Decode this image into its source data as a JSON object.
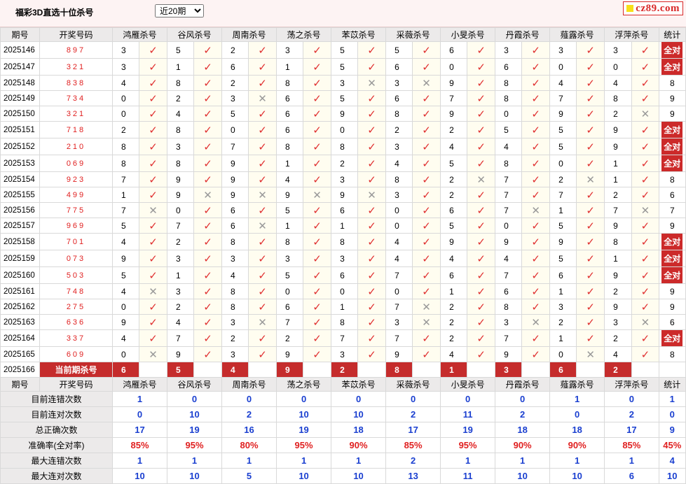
{
  "title": "福彩3D直选十位杀号",
  "period_select": {
    "selected": "近20期",
    "options": [
      "近20期"
    ]
  },
  "logo": {
    "text": "cz89.com"
  },
  "headers": [
    "期号",
    "开奖号码",
    "鸿雁杀号",
    "谷风杀号",
    "周南杀号",
    "荡之杀号",
    "苯苡杀号",
    "采薇杀号",
    "小旻杀号",
    "丹霞杀号",
    "薤露杀号",
    "浮萍杀号",
    "统计"
  ],
  "rows": [
    {
      "issue": "2025146",
      "win": "897",
      "picks": [
        [
          3,
          1
        ],
        [
          5,
          1
        ],
        [
          2,
          1
        ],
        [
          3,
          1
        ],
        [
          5,
          1
        ],
        [
          5,
          1
        ],
        [
          6,
          1
        ],
        [
          3,
          1
        ],
        [
          3,
          1
        ],
        [
          3,
          1
        ]
      ],
      "stat": "全对"
    },
    {
      "issue": "2025147",
      "win": "321",
      "picks": [
        [
          3,
          1
        ],
        [
          1,
          1
        ],
        [
          6,
          1
        ],
        [
          1,
          1
        ],
        [
          5,
          1
        ],
        [
          6,
          1
        ],
        [
          0,
          1
        ],
        [
          6,
          1
        ],
        [
          0,
          1
        ],
        [
          0,
          1
        ]
      ],
      "stat": "全对"
    },
    {
      "issue": "2025148",
      "win": "838",
      "picks": [
        [
          4,
          1
        ],
        [
          8,
          1
        ],
        [
          2,
          1
        ],
        [
          8,
          1
        ],
        [
          3,
          0
        ],
        [
          3,
          0
        ],
        [
          9,
          1
        ],
        [
          8,
          1
        ],
        [
          4,
          1
        ],
        [
          4,
          1
        ]
      ],
      "stat": "8"
    },
    {
      "issue": "2025149",
      "win": "734",
      "picks": [
        [
          0,
          1
        ],
        [
          2,
          1
        ],
        [
          3,
          0
        ],
        [
          6,
          1
        ],
        [
          5,
          1
        ],
        [
          6,
          1
        ],
        [
          7,
          1
        ],
        [
          8,
          1
        ],
        [
          7,
          1
        ],
        [
          8,
          1
        ]
      ],
      "stat": "9"
    },
    {
      "issue": "2025150",
      "win": "321",
      "picks": [
        [
          0,
          1
        ],
        [
          4,
          1
        ],
        [
          5,
          1
        ],
        [
          6,
          1
        ],
        [
          9,
          1
        ],
        [
          8,
          1
        ],
        [
          9,
          1
        ],
        [
          0,
          1
        ],
        [
          9,
          1
        ],
        [
          2,
          0
        ]
      ],
      "stat": "9"
    },
    {
      "issue": "2025151",
      "win": "718",
      "picks": [
        [
          2,
          1
        ],
        [
          8,
          1
        ],
        [
          0,
          1
        ],
        [
          6,
          1
        ],
        [
          0,
          1
        ],
        [
          2,
          1
        ],
        [
          2,
          1
        ],
        [
          5,
          1
        ],
        [
          5,
          1
        ],
        [
          9,
          1
        ]
      ],
      "stat": "全对"
    },
    {
      "issue": "2025152",
      "win": "210",
      "picks": [
        [
          8,
          1
        ],
        [
          3,
          1
        ],
        [
          7,
          1
        ],
        [
          8,
          1
        ],
        [
          8,
          1
        ],
        [
          3,
          1
        ],
        [
          4,
          1
        ],
        [
          4,
          1
        ],
        [
          5,
          1
        ],
        [
          9,
          1
        ]
      ],
      "stat": "全对"
    },
    {
      "issue": "2025153",
      "win": "069",
      "picks": [
        [
          8,
          1
        ],
        [
          8,
          1
        ],
        [
          9,
          1
        ],
        [
          1,
          1
        ],
        [
          2,
          1
        ],
        [
          4,
          1
        ],
        [
          5,
          1
        ],
        [
          8,
          1
        ],
        [
          0,
          1
        ],
        [
          1,
          1
        ]
      ],
      "stat": "全对"
    },
    {
      "issue": "2025154",
      "win": "923",
      "picks": [
        [
          7,
          1
        ],
        [
          9,
          1
        ],
        [
          9,
          1
        ],
        [
          4,
          1
        ],
        [
          3,
          1
        ],
        [
          8,
          1
        ],
        [
          2,
          0
        ],
        [
          7,
          1
        ],
        [
          2,
          0
        ],
        [
          1,
          1
        ]
      ],
      "stat": "8"
    },
    {
      "issue": "2025155",
      "win": "499",
      "picks": [
        [
          1,
          1
        ],
        [
          9,
          0
        ],
        [
          9,
          0
        ],
        [
          9,
          0
        ],
        [
          9,
          0
        ],
        [
          3,
          1
        ],
        [
          2,
          1
        ],
        [
          7,
          1
        ],
        [
          7,
          1
        ],
        [
          2,
          1
        ]
      ],
      "stat": "6"
    },
    {
      "issue": "2025156",
      "win": "775",
      "picks": [
        [
          7,
          0
        ],
        [
          0,
          1
        ],
        [
          6,
          1
        ],
        [
          5,
          1
        ],
        [
          6,
          1
        ],
        [
          0,
          1
        ],
        [
          6,
          1
        ],
        [
          7,
          0
        ],
        [
          1,
          1
        ],
        [
          7,
          0
        ]
      ],
      "stat": "7"
    },
    {
      "issue": "2025157",
      "win": "969",
      "picks": [
        [
          5,
          1
        ],
        [
          7,
          1
        ],
        [
          6,
          0
        ],
        [
          1,
          1
        ],
        [
          1,
          1
        ],
        [
          0,
          1
        ],
        [
          5,
          1
        ],
        [
          0,
          1
        ],
        [
          5,
          1
        ],
        [
          9,
          1
        ]
      ],
      "stat": "9"
    },
    {
      "issue": "2025158",
      "win": "701",
      "picks": [
        [
          4,
          1
        ],
        [
          2,
          1
        ],
        [
          8,
          1
        ],
        [
          8,
          1
        ],
        [
          8,
          1
        ],
        [
          4,
          1
        ],
        [
          9,
          1
        ],
        [
          9,
          1
        ],
        [
          9,
          1
        ],
        [
          8,
          1
        ]
      ],
      "stat": "全对"
    },
    {
      "issue": "2025159",
      "win": "073",
      "picks": [
        [
          9,
          1
        ],
        [
          3,
          1
        ],
        [
          3,
          1
        ],
        [
          3,
          1
        ],
        [
          3,
          1
        ],
        [
          4,
          1
        ],
        [
          4,
          1
        ],
        [
          4,
          1
        ],
        [
          5,
          1
        ],
        [
          1,
          1
        ]
      ],
      "stat": "全对"
    },
    {
      "issue": "2025160",
      "win": "503",
      "picks": [
        [
          5,
          1
        ],
        [
          1,
          1
        ],
        [
          4,
          1
        ],
        [
          5,
          1
        ],
        [
          6,
          1
        ],
        [
          7,
          1
        ],
        [
          6,
          1
        ],
        [
          7,
          1
        ],
        [
          6,
          1
        ],
        [
          9,
          1
        ]
      ],
      "stat": "全对"
    },
    {
      "issue": "2025161",
      "win": "748",
      "picks": [
        [
          4,
          0
        ],
        [
          3,
          1
        ],
        [
          8,
          1
        ],
        [
          0,
          1
        ],
        [
          0,
          1
        ],
        [
          0,
          1
        ],
        [
          1,
          1
        ],
        [
          6,
          1
        ],
        [
          1,
          1
        ],
        [
          2,
          1
        ]
      ],
      "stat": "9"
    },
    {
      "issue": "2025162",
      "win": "275",
      "picks": [
        [
          0,
          1
        ],
        [
          2,
          1
        ],
        [
          8,
          1
        ],
        [
          6,
          1
        ],
        [
          1,
          1
        ],
        [
          7,
          0
        ],
        [
          2,
          1
        ],
        [
          8,
          1
        ],
        [
          3,
          1
        ],
        [
          9,
          1
        ]
      ],
      "stat": "9"
    },
    {
      "issue": "2025163",
      "win": "636",
      "picks": [
        [
          9,
          1
        ],
        [
          4,
          1
        ],
        [
          3,
          0
        ],
        [
          7,
          1
        ],
        [
          8,
          1
        ],
        [
          3,
          0
        ],
        [
          2,
          1
        ],
        [
          3,
          0
        ],
        [
          2,
          1
        ],
        [
          3,
          0
        ]
      ],
      "stat": "6"
    },
    {
      "issue": "2025164",
      "win": "337",
      "picks": [
        [
          4,
          1
        ],
        [
          7,
          1
        ],
        [
          2,
          1
        ],
        [
          2,
          1
        ],
        [
          7,
          1
        ],
        [
          7,
          1
        ],
        [
          2,
          1
        ],
        [
          7,
          1
        ],
        [
          1,
          1
        ],
        [
          2,
          1
        ]
      ],
      "stat": "全对"
    },
    {
      "issue": "2025165",
      "win": "609",
      "picks": [
        [
          0,
          0
        ],
        [
          9,
          1
        ],
        [
          3,
          1
        ],
        [
          9,
          1
        ],
        [
          3,
          1
        ],
        [
          9,
          1
        ],
        [
          4,
          1
        ],
        [
          9,
          1
        ],
        [
          0,
          0
        ],
        [
          4,
          1
        ]
      ],
      "stat": "8"
    }
  ],
  "current": {
    "issue": "2025166",
    "label": "当前期杀号",
    "picks": [
      6,
      5,
      4,
      9,
      2,
      8,
      1,
      3,
      6,
      2
    ]
  },
  "summary_headers": [
    "期号",
    "开奖号码",
    "鸿雁杀号",
    "谷风杀号",
    "周南杀号",
    "荡之杀号",
    "苯苡杀号",
    "采薇杀号",
    "小旻杀号",
    "丹霞杀号",
    "薤露杀号",
    "浮萍杀号",
    "统计"
  ],
  "summary": [
    {
      "label": "目前连错次数",
      "values": [
        "1",
        "0",
        "0",
        "0",
        "0",
        "0",
        "0",
        "0",
        "1",
        "0",
        "1"
      ]
    },
    {
      "label": "目前连对次数",
      "values": [
        "0",
        "10",
        "2",
        "10",
        "10",
        "2",
        "11",
        "2",
        "0",
        "2",
        "0"
      ]
    },
    {
      "label": "总正确次数",
      "values": [
        "17",
        "19",
        "16",
        "19",
        "18",
        "17",
        "19",
        "18",
        "18",
        "17",
        "9"
      ]
    },
    {
      "label": "准确率(全对率)",
      "values": [
        "85%",
        "95%",
        "80%",
        "95%",
        "90%",
        "85%",
        "95%",
        "90%",
        "90%",
        "85%",
        "45%"
      ],
      "red": true
    },
    {
      "label": "最大连错次数",
      "values": [
        "1",
        "1",
        "1",
        "1",
        "1",
        "2",
        "1",
        "1",
        "1",
        "1",
        "4"
      ]
    },
    {
      "label": "最大连对次数",
      "values": [
        "10",
        "10",
        "5",
        "10",
        "10",
        "13",
        "11",
        "10",
        "10",
        "6",
        "10"
      ]
    }
  ]
}
